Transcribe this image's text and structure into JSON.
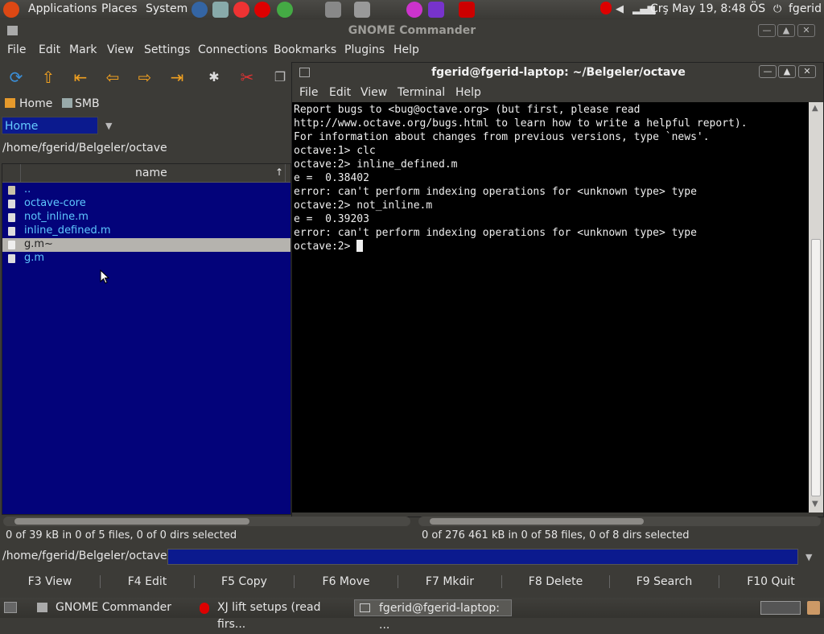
{
  "top_panel": {
    "menus": [
      "Applications",
      "Places",
      "System"
    ],
    "clock": "Çrş May 19,  8:48 ÖS",
    "user": "fgerid"
  },
  "commander": {
    "title": "GNOME Commander",
    "menu": [
      "File",
      "Edit",
      "Mark",
      "View",
      "Settings",
      "Connections",
      "Bookmarks",
      "Plugins",
      "Help"
    ],
    "bookmarks": [
      "Home",
      "SMB"
    ],
    "location_select": "Home",
    "path": "/home/fgerid/Belgeler/octave",
    "column_header": "name",
    "sort_indicator": "↑",
    "files": [
      {
        "name": ".."
      },
      {
        "name": "octave-core"
      },
      {
        "name": "not_inline.m"
      },
      {
        "name": "inline_defined.m"
      },
      {
        "name": "g.m~"
      },
      {
        "name": "g.m"
      }
    ],
    "status_left": "0  of 39  kB in 0 of 5 files, 0 of 0 dirs selected",
    "status_right": "0  of 276 461  kB in 0 of 58 files, 0 of 8 dirs selected",
    "cmdline_label": "/home/fgerid/Belgeler/octave #",
    "function_keys": [
      "F3 View",
      "F4 Edit",
      "F5 Copy",
      "F6 Move",
      "F7 Mkdir",
      "F8 Delete",
      "F9 Search",
      "F10 Quit"
    ]
  },
  "terminal": {
    "title": "fgerid@fgerid-laptop: ~/Belgeler/octave",
    "menu": [
      "File",
      "Edit",
      "View",
      "Terminal",
      "Help"
    ],
    "lines": [
      "Report bugs to <bug@octave.org> (but first, please read",
      "http://www.octave.org/bugs.html to learn how to write a helpful report).",
      "",
      "For information about changes from previous versions, type `news'.",
      "",
      "octave:1> clc",
      "octave:2> inline_defined.m",
      "e =  0.38402",
      "error: can't perform indexing operations for <unknown type> type",
      "octave:2> not_inline.m",
      "e =  0.39203",
      "error: can't perform indexing operations for <unknown type> type"
    ],
    "prompt": "octave:2> "
  },
  "taskbar": {
    "tasks": [
      "GNOME Commander",
      "XJ lift setups (read firs...",
      "fgerid@fgerid-laptop: ..."
    ]
  }
}
